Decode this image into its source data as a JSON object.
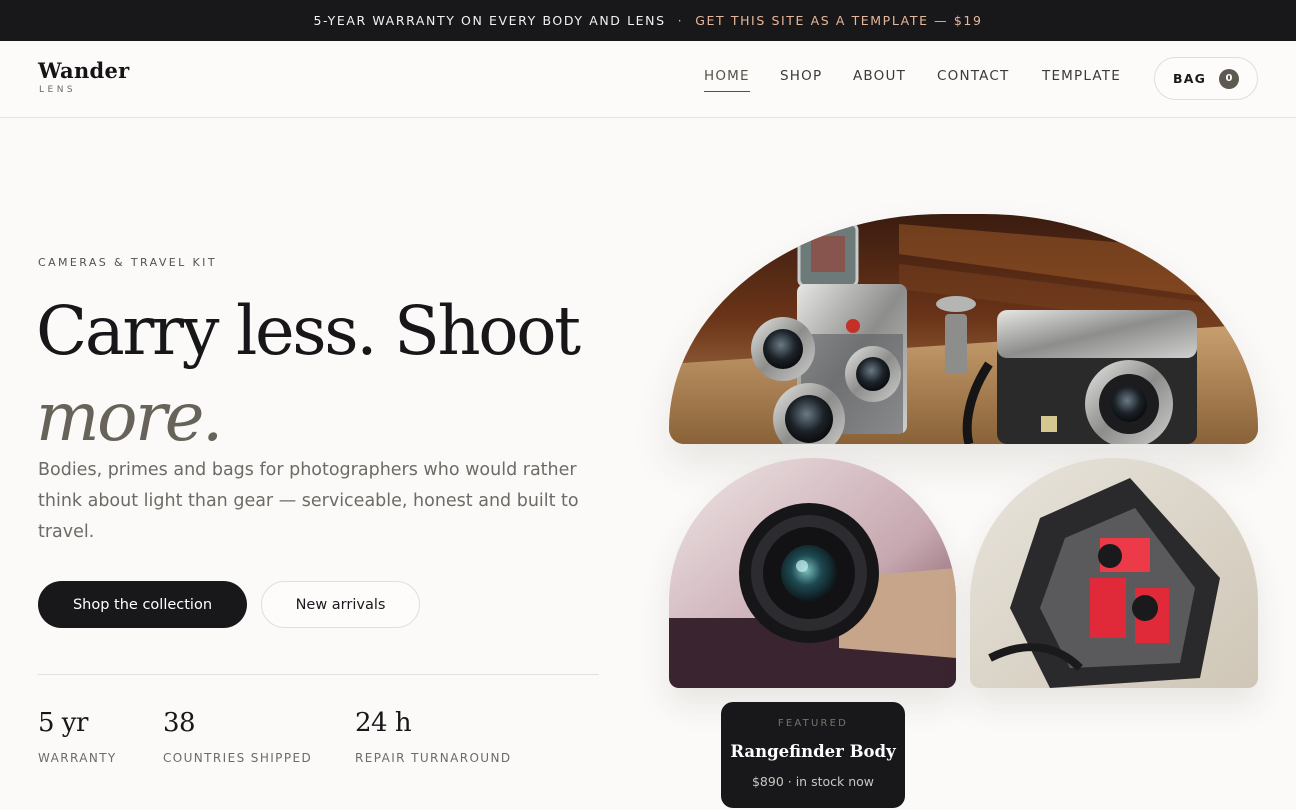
{
  "announcement": {
    "message": "5-YEAR WARRANTY ON EVERY BODY AND LENS",
    "separator": "·",
    "link": "GET THIS SITE AS A TEMPLATE — $19"
  },
  "brand": {
    "name": "Wander",
    "sub": "LENS"
  },
  "nav": {
    "items": [
      "HOME",
      "SHOP",
      "ABOUT",
      "CONTACT",
      "TEMPLATE"
    ],
    "active": "HOME"
  },
  "bag": {
    "label": "BAG",
    "count": "0"
  },
  "hero": {
    "eyebrow": "CAMERAS & TRAVEL KIT",
    "headline_line1": "Carry less. Shoot",
    "headline_line2": "more.",
    "lede": "Bodies, primes and bags for photographers who would rather think about light than gear — serviceable, honest and built to travel.",
    "primary_cta": "Shop the collection",
    "secondary_cta": "New arrivals"
  },
  "stats": [
    {
      "value": "5 yr",
      "label": "WARRANTY"
    },
    {
      "value": "38",
      "label": "COUNTRIES SHIPPED"
    },
    {
      "value": "24 h",
      "label": "REPAIR TURNAROUND"
    }
  ],
  "featured": {
    "kicker": "FEATURED",
    "title": "Rangefinder Body",
    "price": "$890 · in stock now"
  },
  "images": {
    "main": "vintage-cameras-photo",
    "lens": "camera-lens-photo",
    "bag": "camera-backpack-photo"
  },
  "colors": {
    "background": "#fbfaf8",
    "ink": "#18181b",
    "accent": "#67625a",
    "link": "#e6b79a"
  }
}
